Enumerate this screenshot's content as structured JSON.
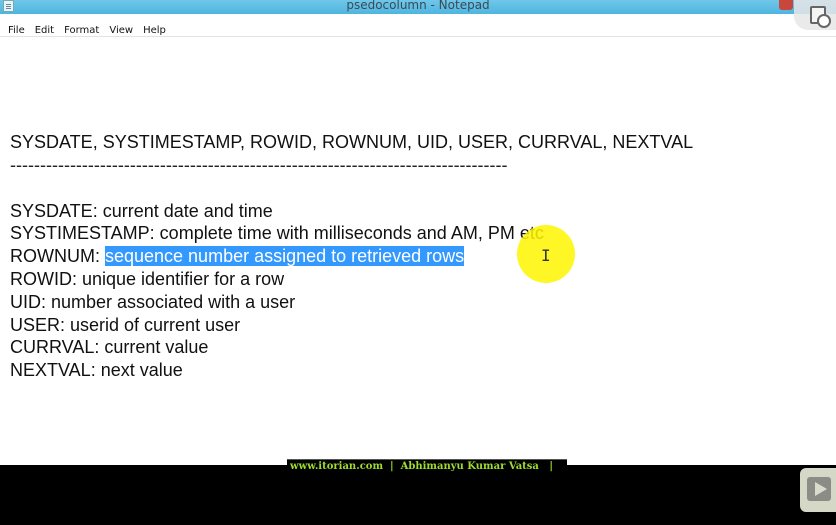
{
  "window": {
    "title": "psedocolumn - Notepad"
  },
  "menu": {
    "items": [
      "File",
      "Edit",
      "Format",
      "View",
      "Help"
    ]
  },
  "document": {
    "header": "SYSDATE, SYSTIMESTAMP, ROWID, ROWNUM, UID, USER, CURRVAL, NEXTVAL",
    "separator": "-----------------------------------------------------------------------------------",
    "lines": [
      "SYSDATE: current date and time",
      "SYSTIMESTAMP: complete time with milliseconds and AM, PM etc",
      "ROWNUM: ",
      "ROWID: unique identifier for a row",
      "UID: number associated with a user",
      "USER: userid of current user",
      "CURRVAL: current value",
      "NEXTVAL: next value"
    ],
    "selected_text": "sequence number assigned to retrieved rows"
  },
  "footer": {
    "caption": "www.itorian.com  |  Abhimanyu Kumar Vatsa   |"
  },
  "colors": {
    "titlebar": "#5bbde4",
    "selection": "#3399ff",
    "cursor_highlight": "#fff500",
    "caption_text": "#9fdc2f"
  },
  "icons": {
    "app": "notepad-icon",
    "close": "close-icon",
    "overlay": "screen-recorder-icon",
    "play": "play-icon"
  }
}
